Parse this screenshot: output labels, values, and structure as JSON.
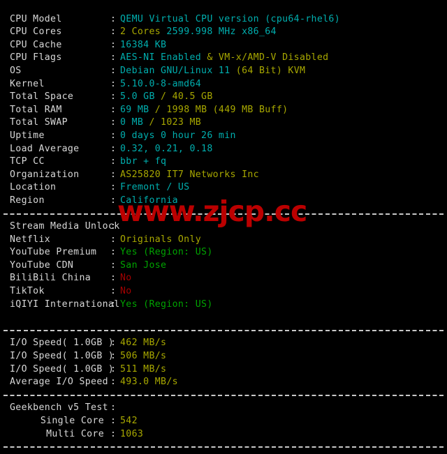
{
  "terminal": {
    "background": "#000000",
    "colors": {
      "label": "#d8d8d8",
      "cyan": "#00aeae",
      "yellow": "#a8a800",
      "green": "#00a300",
      "red": "#a40000",
      "watermark": "#bb0000"
    },
    "colon": ":"
  },
  "watermark": {
    "text": "www.zjcp.cc"
  },
  "system": {
    "rows": [
      {
        "label": "CPU Model",
        "parts": [
          {
            "text": "QEMU Virtual CPU version (cpu64-rhel6)",
            "color": "cyan"
          }
        ]
      },
      {
        "label": "CPU Cores",
        "parts": [
          {
            "text": "2 Cores ",
            "color": "yellow"
          },
          {
            "text": "2599.998 MHz x86_64",
            "color": "cyan"
          }
        ]
      },
      {
        "label": "CPU Cache",
        "parts": [
          {
            "text": "16384 KB",
            "color": "cyan"
          }
        ]
      },
      {
        "label": "CPU Flags",
        "parts": [
          {
            "text": "AES-NI Enabled ",
            "color": "cyan"
          },
          {
            "text": "& VM-x/AMD-V Disabled",
            "color": "yellow"
          }
        ]
      },
      {
        "label": "OS",
        "parts": [
          {
            "text": "Debian GNU/Linux 11 ",
            "color": "cyan"
          },
          {
            "text": "(64 Bit) KVM",
            "color": "yellow"
          }
        ]
      },
      {
        "label": "Kernel",
        "parts": [
          {
            "text": "5.10.0-8-amd64",
            "color": "cyan"
          }
        ]
      },
      {
        "label": "Total Space",
        "parts": [
          {
            "text": "5.0 GB ",
            "color": "cyan"
          },
          {
            "text": "/ 40.5 GB",
            "color": "yellow"
          }
        ]
      },
      {
        "label": "Total RAM",
        "parts": [
          {
            "text": "69 MB ",
            "color": "cyan"
          },
          {
            "text": "/ 1998 MB (449 MB Buff)",
            "color": "yellow"
          }
        ]
      },
      {
        "label": "Total SWAP",
        "parts": [
          {
            "text": "0 MB ",
            "color": "cyan"
          },
          {
            "text": "/ 1023 MB",
            "color": "yellow"
          }
        ]
      },
      {
        "label": "Uptime",
        "parts": [
          {
            "text": "0 days 0 hour 26 min",
            "color": "cyan"
          }
        ]
      },
      {
        "label": "Load Average",
        "parts": [
          {
            "text": "0.32, 0.21, 0.18",
            "color": "cyan"
          }
        ]
      },
      {
        "label": "TCP CC",
        "parts": [
          {
            "text": "bbr + fq",
            "color": "cyan"
          }
        ]
      },
      {
        "label": "Organization",
        "parts": [
          {
            "text": "AS25820 IT7 Networks Inc",
            "color": "yellow"
          }
        ]
      },
      {
        "label": "Location",
        "parts": [
          {
            "text": "Fremont / US",
            "color": "cyan"
          }
        ]
      },
      {
        "label": "Region",
        "parts": [
          {
            "text": "California",
            "color": "cyan"
          }
        ]
      }
    ]
  },
  "stream_media": {
    "rows": [
      {
        "label": "Stream Media Unlock",
        "parts": []
      },
      {
        "label": "Netflix",
        "parts": [
          {
            "text": "Originals Only",
            "color": "yellow"
          }
        ]
      },
      {
        "label": "YouTube Premium",
        "parts": [
          {
            "text": "Yes (Region: US)",
            "color": "green"
          }
        ]
      },
      {
        "label": "YouTube CDN",
        "parts": [
          {
            "text": "San Jose",
            "color": "green"
          }
        ]
      },
      {
        "label": "BiliBili China",
        "parts": [
          {
            "text": "No",
            "color": "red"
          }
        ]
      },
      {
        "label": "TikTok",
        "parts": [
          {
            "text": "No",
            "color": "red"
          }
        ]
      },
      {
        "label": "iQIYI International",
        "parts": [
          {
            "text": "Yes (Region: US)",
            "color": "green"
          }
        ]
      }
    ]
  },
  "io_speed": {
    "rows": [
      {
        "label": "I/O Speed( 1.0GB )",
        "parts": [
          {
            "text": "462 MB/s",
            "color": "yellow"
          }
        ]
      },
      {
        "label": "I/O Speed( 1.0GB )",
        "parts": [
          {
            "text": "506 MB/s",
            "color": "yellow"
          }
        ]
      },
      {
        "label": "I/O Speed( 1.0GB )",
        "parts": [
          {
            "text": "511 MB/s",
            "color": "yellow"
          }
        ]
      },
      {
        "label": "Average I/O Speed",
        "parts": [
          {
            "text": "493.0 MB/s",
            "color": "yellow"
          }
        ]
      }
    ]
  },
  "geekbench": {
    "rows": [
      {
        "label": "Geekbench v5 Test",
        "indent": false,
        "parts": []
      },
      {
        "label": "Single Core",
        "indent": true,
        "parts": [
          {
            "text": "542",
            "color": "yellow"
          }
        ]
      },
      {
        "label": "Multi Core",
        "indent": true,
        "parts": [
          {
            "text": "1063",
            "color": "yellow"
          }
        ]
      }
    ]
  }
}
